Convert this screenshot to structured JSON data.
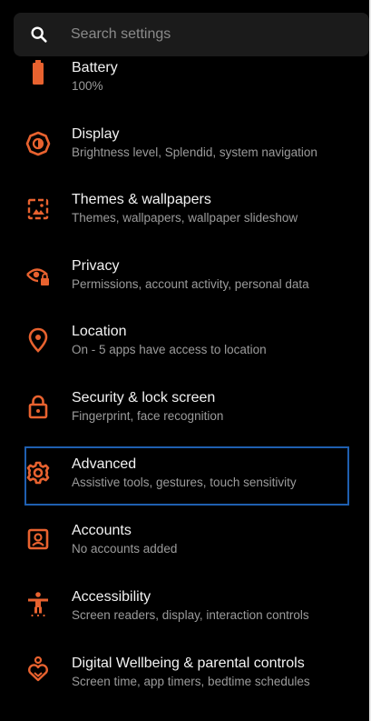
{
  "search": {
    "placeholder": "Search settings",
    "icon": "search-icon"
  },
  "accent_color": "#e8622f",
  "items": [
    {
      "title": "Battery",
      "subtitle": "100%",
      "icon": "battery-icon"
    },
    {
      "title": "Display",
      "subtitle": "Brightness level, Splendid, system navigation",
      "icon": "display-brightness-icon"
    },
    {
      "title": "Themes & wallpapers",
      "subtitle": "Themes, wallpapers, wallpaper slideshow",
      "icon": "wallpaper-icon"
    },
    {
      "title": "Privacy",
      "subtitle": "Permissions, account activity, personal data",
      "icon": "privacy-eye-lock-icon"
    },
    {
      "title": "Location",
      "subtitle": "On - 5 apps have access to location",
      "icon": "location-pin-icon"
    },
    {
      "title": "Security & lock screen",
      "subtitle": "Fingerprint, face recognition",
      "icon": "lock-icon"
    },
    {
      "title": "Advanced",
      "subtitle": "Assistive tools, gestures, touch sensitivity",
      "icon": "gear-icon"
    },
    {
      "title": "Accounts",
      "subtitle": "No accounts added",
      "icon": "account-icon"
    },
    {
      "title": "Accessibility",
      "subtitle": "Screen readers, display, interaction controls",
      "icon": "accessibility-icon"
    },
    {
      "title": "Digital Wellbeing & parental controls",
      "subtitle": "Screen time, app timers, bedtime schedules",
      "icon": "wellbeing-heart-icon"
    }
  ]
}
